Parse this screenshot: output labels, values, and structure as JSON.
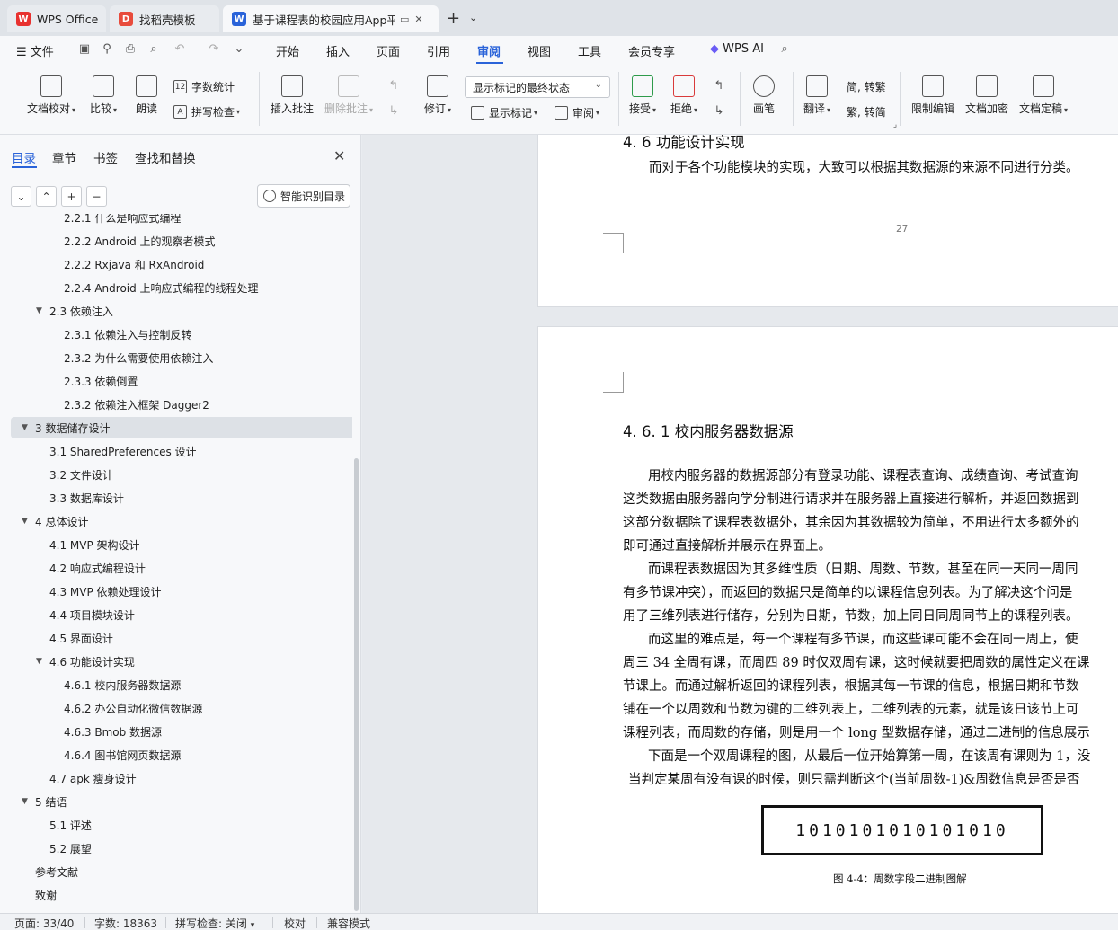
{
  "tabs": [
    {
      "label": "WPS Office",
      "logo": "W",
      "logo_color": "#e8312f"
    },
    {
      "label": "找稻壳模板",
      "logo": "D",
      "logo_color": "#e84b3c"
    },
    {
      "label": "基于课程表的校园应用App平台",
      "logo": "W",
      "logo_color": "#2a63d9"
    }
  ],
  "menu": {
    "file": "文件",
    "items": [
      "开始",
      "插入",
      "页面",
      "引用",
      "审阅",
      "视图",
      "工具",
      "会员专享"
    ],
    "active": "审阅",
    "wps_ai": "WPS AI"
  },
  "ribbon": {
    "doc_check": "文档校对",
    "compare": "比较",
    "read_aloud": "朗读",
    "word_count": "字数统计",
    "spell_check": "拼写检查",
    "insert_comment": "插入批注",
    "delete_comment": "删除批注",
    "revise": "修订",
    "markup_state": "显示标记的最终状态",
    "show_markup": "显示标记",
    "review": "审阅",
    "accept": "接受",
    "reject": "拒绝",
    "pen": "画笔",
    "translate": "翻译",
    "to_traditional": "简, 转繁",
    "to_simplified": "繁, 转简",
    "restrict_edit": "限制编辑",
    "doc_encrypt": "文档加密",
    "doc_finalize": "文档定稿"
  },
  "nav": {
    "tabs": [
      "目录",
      "章节",
      "书签",
      "查找和替换"
    ],
    "active_tab": "目录",
    "smart_toc": "智能识别目录",
    "items": [
      {
        "label": "2.2.1 什么是响应式编程",
        "level": 3
      },
      {
        "label": "2.2.2 Android 上的观察者模式",
        "level": 3
      },
      {
        "label": "2.2.2 Rxjava 和 RxAndroid",
        "level": 3
      },
      {
        "label": "2.2.4 Android 上响应式编程的线程处理",
        "level": 3
      },
      {
        "label": "2.3  依赖注入",
        "level": 2,
        "expanded": true
      },
      {
        "label": "2.3.1 依赖注入与控制反转",
        "level": 3
      },
      {
        "label": "2.3.2 为什么需要使用依赖注入",
        "level": 3
      },
      {
        "label": "2.3.3  依赖倒置",
        "level": 3
      },
      {
        "label": "2.3.2  依赖注入框架 Dagger2",
        "level": 3
      },
      {
        "label": "3  数据储存设计",
        "level": 1,
        "expanded": true,
        "selected": true
      },
      {
        "label": "3.1 SharedPreferences 设计",
        "level": 2
      },
      {
        "label": "3.2  文件设计",
        "level": 2
      },
      {
        "label": "3.3  数据库设计",
        "level": 2
      },
      {
        "label": "4  总体设计",
        "level": 1,
        "expanded": true
      },
      {
        "label": "4.1 MVP 架构设计",
        "level": 2
      },
      {
        "label": "4.2  响应式编程设计",
        "level": 2
      },
      {
        "label": "4.3 MVP 依赖处理设计",
        "level": 2
      },
      {
        "label": "4.4  项目模块设计",
        "level": 2
      },
      {
        "label": "4.5  界面设计",
        "level": 2
      },
      {
        "label": "4.6  功能设计实现",
        "level": 2,
        "expanded": true
      },
      {
        "label": "4.6.1 校内服务器数据源",
        "level": 3
      },
      {
        "label": "4.6.2  办公自动化微信数据源",
        "level": 3
      },
      {
        "label": "4.6.3 Bmob 数据源",
        "level": 3
      },
      {
        "label": "4.6.4  图书馆网页数据源",
        "level": 3
      },
      {
        "label": "4.7 apk 瘦身设计",
        "level": 2
      },
      {
        "label": "5  结语",
        "level": 1,
        "expanded": true
      },
      {
        "label": "5.1  评述",
        "level": 2
      },
      {
        "label": "5.2  展望",
        "level": 2
      },
      {
        "label": "参考文献",
        "level": 1
      },
      {
        "label": "致谢",
        "level": 1
      }
    ]
  },
  "document": {
    "page1_heading": "4. 6  功能设计实现",
    "page1_text": "而对于各个功能模块的实现，大致可以根据其数据源的来源不同进行分类。",
    "page_number": "27",
    "section_heading": "4. 6. 1 校内服务器数据源",
    "lines": [
      "用校内服务器的数据源部分有登录功能、课程表查询、成绩查询、考试查询",
      "这类数据由服务器向学分制进行请求并在服务器上直接进行解析，并返回数据到",
      "这部分数据除了课程表数据外，其余因为其数据较为简单，不用进行太多额外的",
      "即可通过直接解析并展示在界面上。",
      "而课程表数据因为其多维性质（日期、周数、节数，甚至在同一天同一周同",
      "有多节课冲突），而返回的数据只是简单的以课程信息列表。为了解决这个问是",
      "用了三维列表进行储存，分别为日期，节数，加上同日同周同节上的课程列表。",
      "而这里的难点是，每一个课程有多节课，而这些课可能不会在同一周上，使",
      "周三 34 全周有课，而周四 89 时仅双周有课，这时候就要把周数的属性定义在课",
      "节课上。而通过解析返回的课程列表，根据其每一节课的信息，根据日期和节数",
      "铺在一个以周数和节数为键的二维列表上，二维列表的元素，就是该日该节上可",
      "课程列表，而周数的存储，则是用一个 long 型数据存储，通过二进制的信息展示",
      "下面是一个双周课程的图，从最后一位开始算第一周，在该周有课则为 1，没",
      "当判定某周有没有课的时候，则只需判断这个(当前周数-1)&周数信息是否是否"
    ],
    "binary": "1010101010101010",
    "figure_caption": "图 4-4：周数字段二进制图解"
  },
  "status": {
    "page": "页面: 33/40",
    "word_count": "字数: 18363",
    "spell_check": "拼写检查: 关闭",
    "proofread": "校对",
    "compat_mode": "兼容模式"
  }
}
